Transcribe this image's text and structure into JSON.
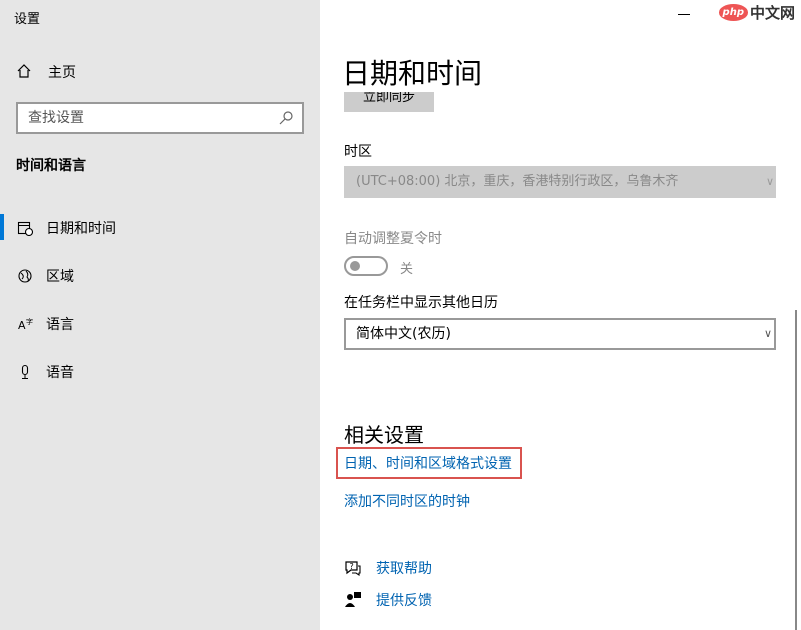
{
  "app": {
    "title": "设置"
  },
  "sidebar": {
    "home_label": "主页",
    "search_placeholder": "查找设置",
    "section_title": "时间和语言",
    "items": [
      {
        "label": "日期和时间",
        "icon": "calendar-clock-icon",
        "active": true
      },
      {
        "label": "区域",
        "icon": "globe-icon",
        "active": false
      },
      {
        "label": "语言",
        "icon": "language-icon",
        "active": false
      },
      {
        "label": "语音",
        "icon": "microphone-icon",
        "active": false
      }
    ]
  },
  "watermark": {
    "badge": "php",
    "text": "中文网"
  },
  "main": {
    "title": "日期和时间",
    "sync_button_label": "立即同步",
    "timezone_label": "时区",
    "timezone_value": "(UTC+08:00) 北京，重庆，香港特别行政区，乌鲁木齐",
    "dst_label": "自动调整夏令时",
    "dst_state": "关",
    "calendar_label": "在任务栏中显示其他日历",
    "calendar_value": "简体中文(农历)",
    "related_title": "相关设置",
    "related_links": [
      "日期、时间和区域格式设置",
      "添加不同时区的时钟"
    ],
    "help_links": [
      {
        "label": "获取帮助",
        "icon": "help-chat-icon"
      },
      {
        "label": "提供反馈",
        "icon": "feedback-icon"
      }
    ]
  },
  "colors": {
    "accent": "#0078d7",
    "link": "#0063b1",
    "highlight": "#d9534f",
    "sidebar_bg": "#e6e6e6"
  }
}
